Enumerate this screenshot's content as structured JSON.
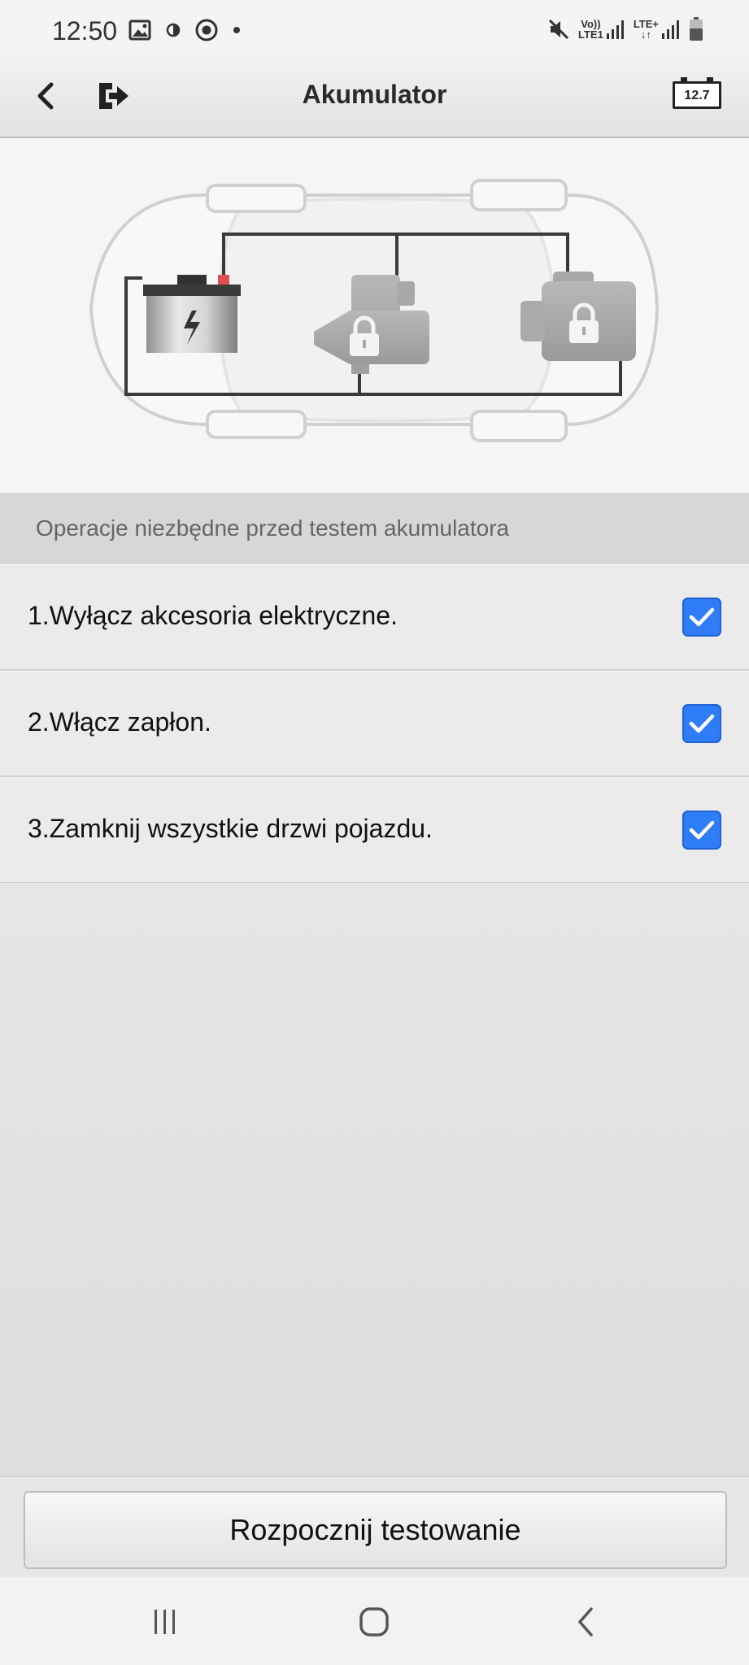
{
  "status_bar": {
    "time": "12:50",
    "left_icons": [
      "image-icon",
      "brightness-icon",
      "record-icon",
      "dot-icon"
    ],
    "right_icons": [
      "mute-icon",
      "volte-signal-icon",
      "lte-signal-icon",
      "battery-icon"
    ],
    "volte_label_top": "Vo))",
    "volte_label_bottom": "LTE1",
    "lte_label_top": "LTE+",
    "lte_label_bottom": "↓↑"
  },
  "header": {
    "title": "Akumulator",
    "back_icon": "back-arrow-icon",
    "exit_icon": "exit-icon",
    "battery_voltage": "12.7"
  },
  "section": {
    "title": "Operacje niezbędne przed testem akumulatora"
  },
  "checklist": [
    {
      "label": "1.Wyłącz akcesoria elektryczne.",
      "checked": true
    },
    {
      "label": "2.Włącz zapłon.",
      "checked": true
    },
    {
      "label": "3.Zamknij wszystkie drzwi pojazdu.",
      "checked": true
    }
  ],
  "footer": {
    "start_button_label": "Rozpocznij testowanie"
  },
  "navigation": {
    "recent_icon": "recent-apps-icon",
    "home_icon": "home-icon",
    "back_icon": "nav-back-icon"
  },
  "colors": {
    "checkbox_blue": "#2f7df6",
    "section_header_bg": "#d7d7d7",
    "battery_terminal_red": "#e05050"
  }
}
